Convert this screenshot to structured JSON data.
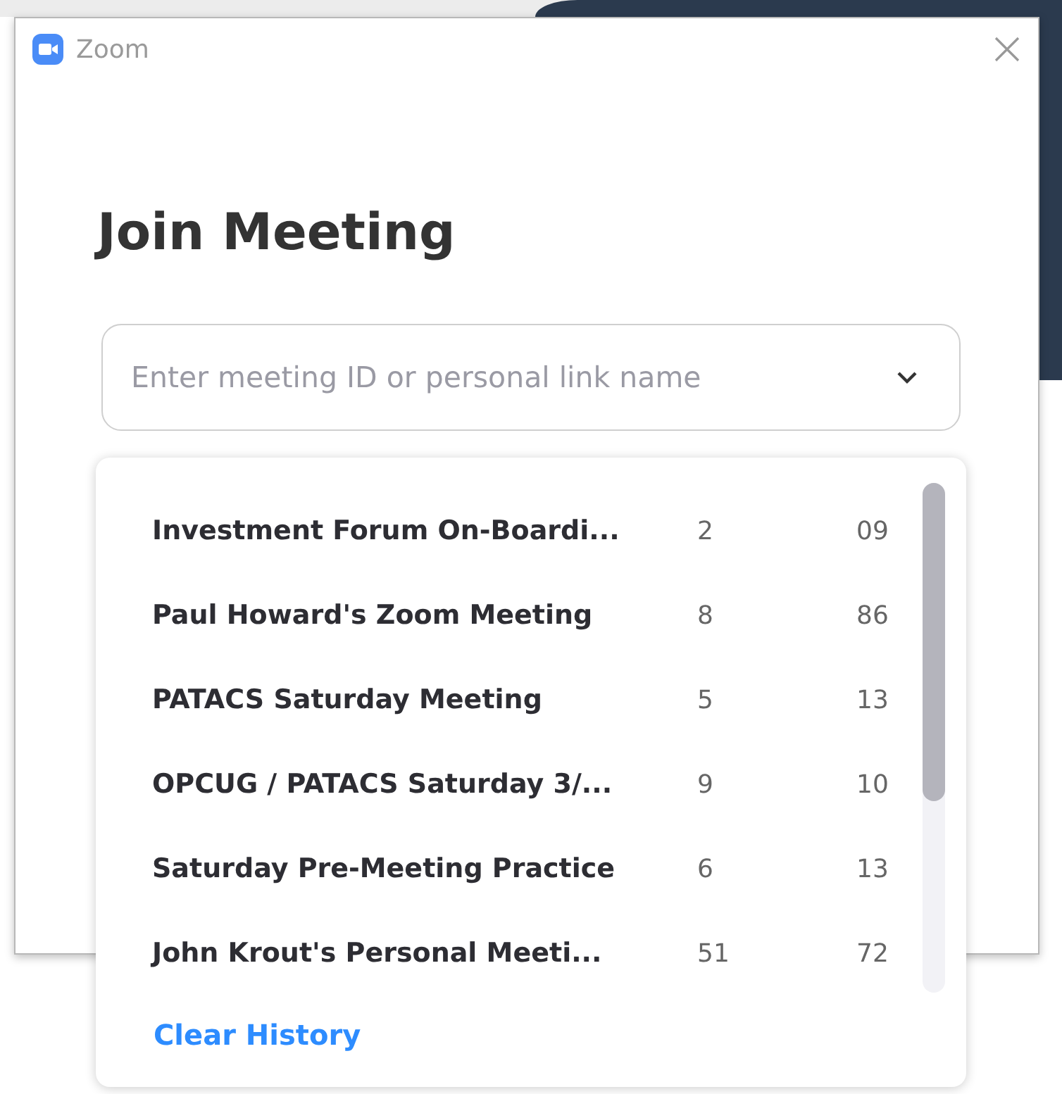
{
  "window": {
    "title": "Zoom"
  },
  "heading": "Join Meeting",
  "meeting_field": {
    "placeholder": "Enter meeting ID or personal link name"
  },
  "history": [
    {
      "name": "Investment Forum On-Boardi...",
      "column_2": "2",
      "column_3": "09"
    },
    {
      "name": "Paul Howard's Zoom Meeting",
      "column_2": "8",
      "column_3": "86"
    },
    {
      "name": "PATACS Saturday Meeting",
      "column_2": "5",
      "column_3": "13"
    },
    {
      "name": "OPCUG / PATACS Saturday 3/...",
      "column_2": "9",
      "column_3": "10"
    },
    {
      "name": "Saturday Pre-Meeting Practice",
      "column_2": "6",
      "column_3": "13"
    },
    {
      "name": "John Krout's Personal Meeti...",
      "column_2": "51",
      "column_3": "72"
    }
  ],
  "clear_history": "Clear History"
}
